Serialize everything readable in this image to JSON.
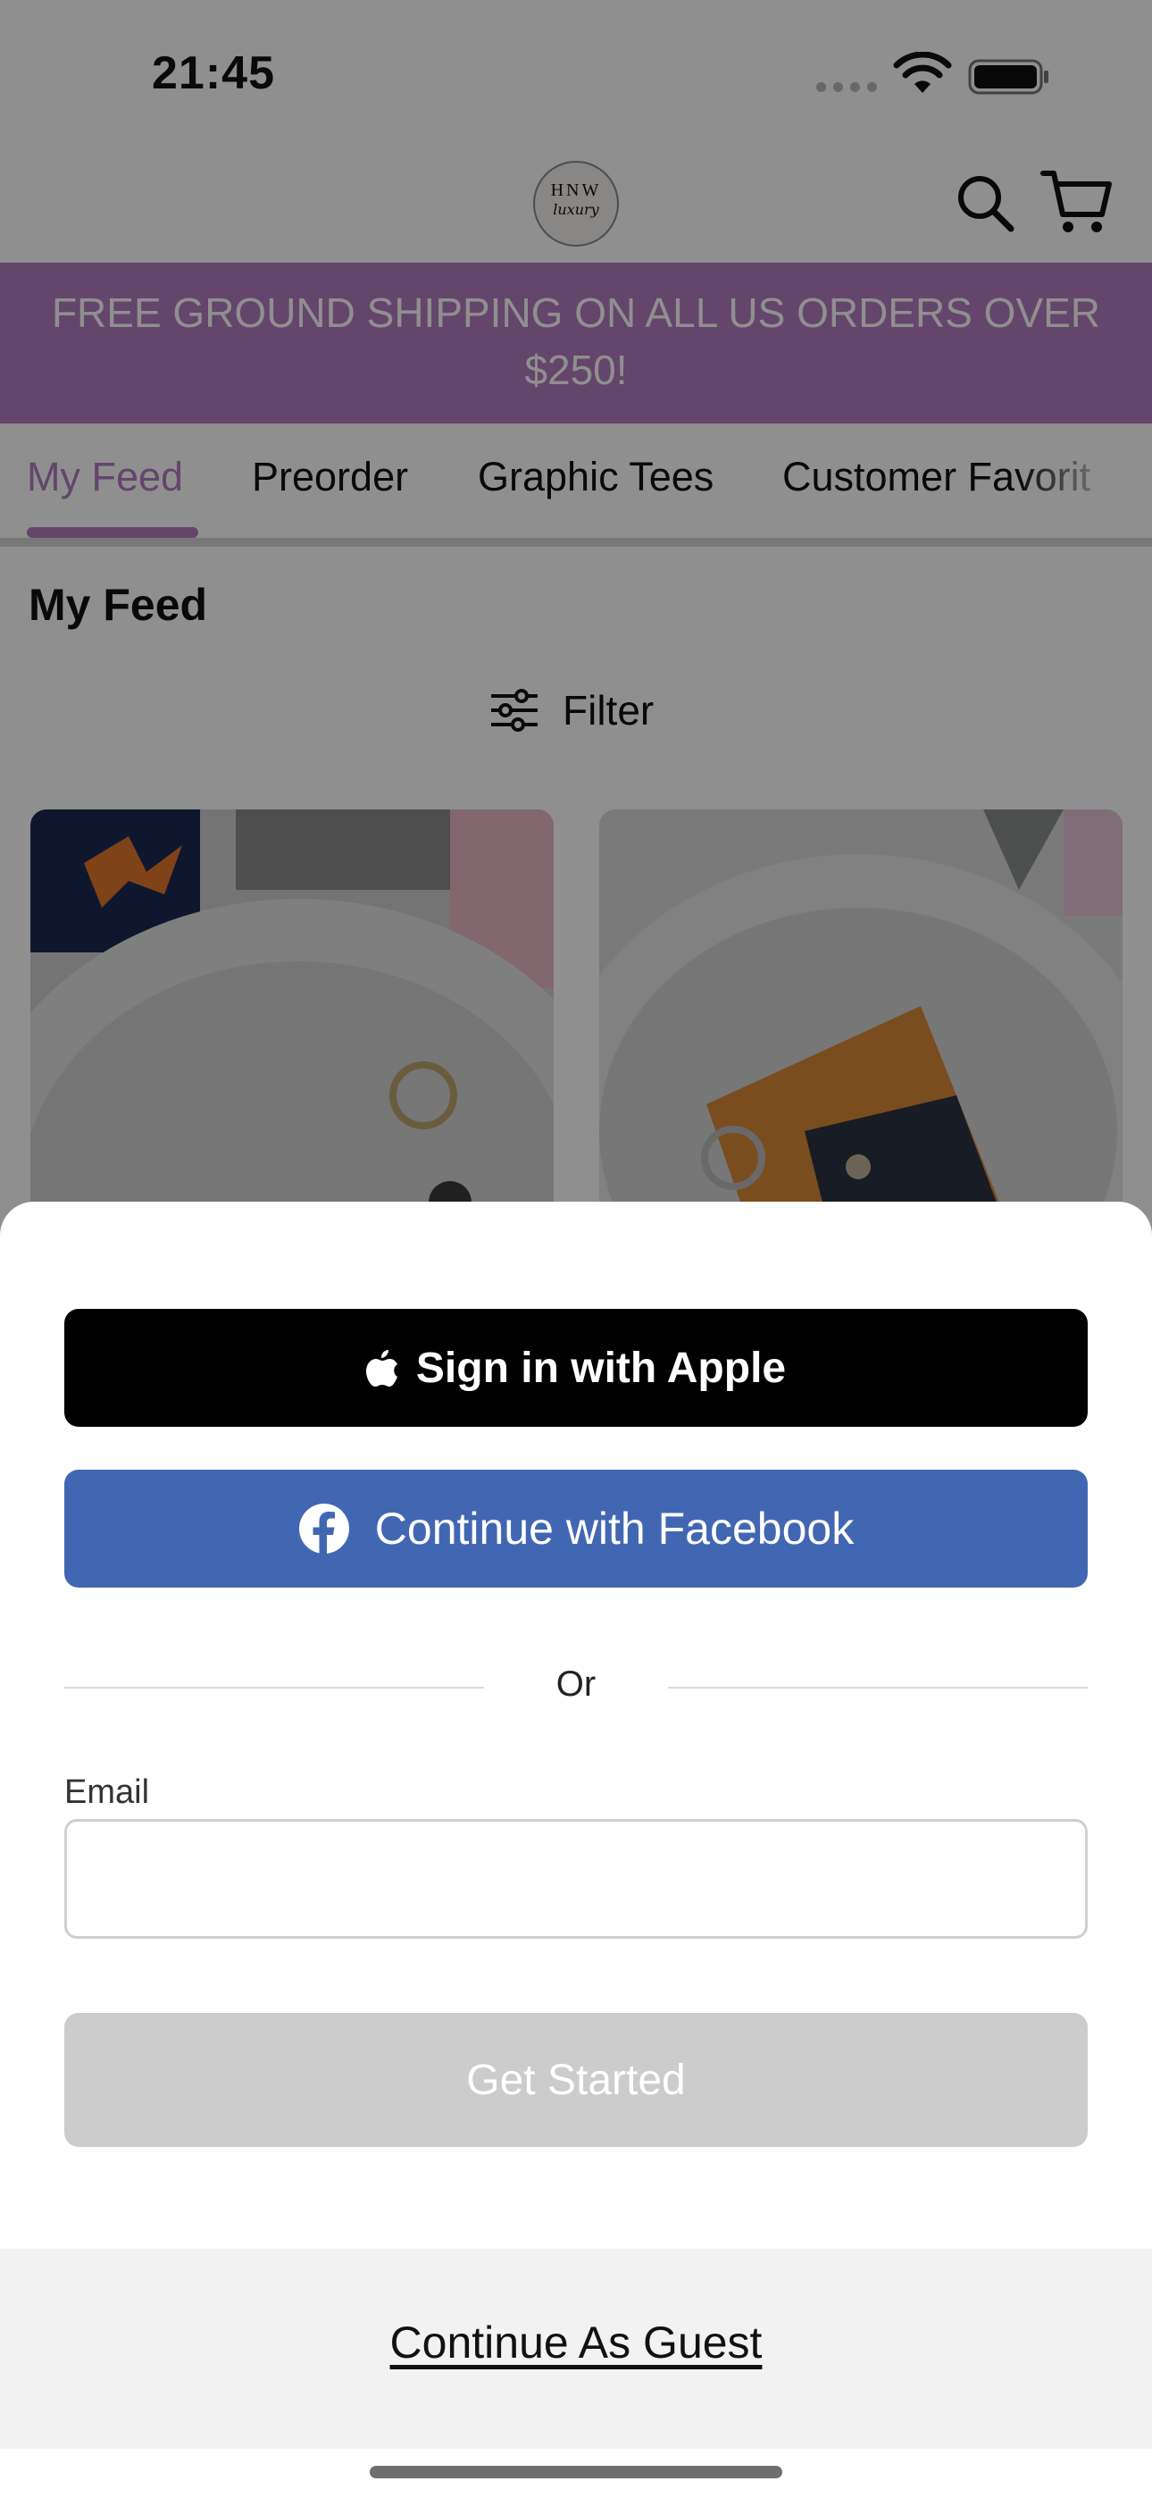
{
  "status_bar": {
    "time": "21:45"
  },
  "header": {
    "logo": {
      "line1": "HNW",
      "line2": "luxury"
    },
    "icons": [
      "search-icon",
      "cart-icon"
    ]
  },
  "promo_banner": {
    "text": "FREE GROUND SHIPPING ON ALL US ORDERS OVER $250!"
  },
  "tabs": [
    {
      "label": "My Feed",
      "active": true
    },
    {
      "label": "Preorder"
    },
    {
      "label": "Graphic Tees"
    },
    {
      "label": "Customer Favorit"
    }
  ],
  "feed": {
    "title": "My Feed",
    "filter_label": "Filter"
  },
  "sheet": {
    "apple_label": "Sign in with Apple",
    "facebook_label": "Continue with Facebook",
    "divider_text": "Or",
    "email_label": "Email",
    "email_value": "",
    "get_started_label": "Get Started",
    "guest_label": "Continue As Guest"
  },
  "colors": {
    "brand_purple": "#b37cbf",
    "facebook_blue": "#4267b2",
    "apple_black": "#000000",
    "disabled_gray": "#cccccc"
  }
}
